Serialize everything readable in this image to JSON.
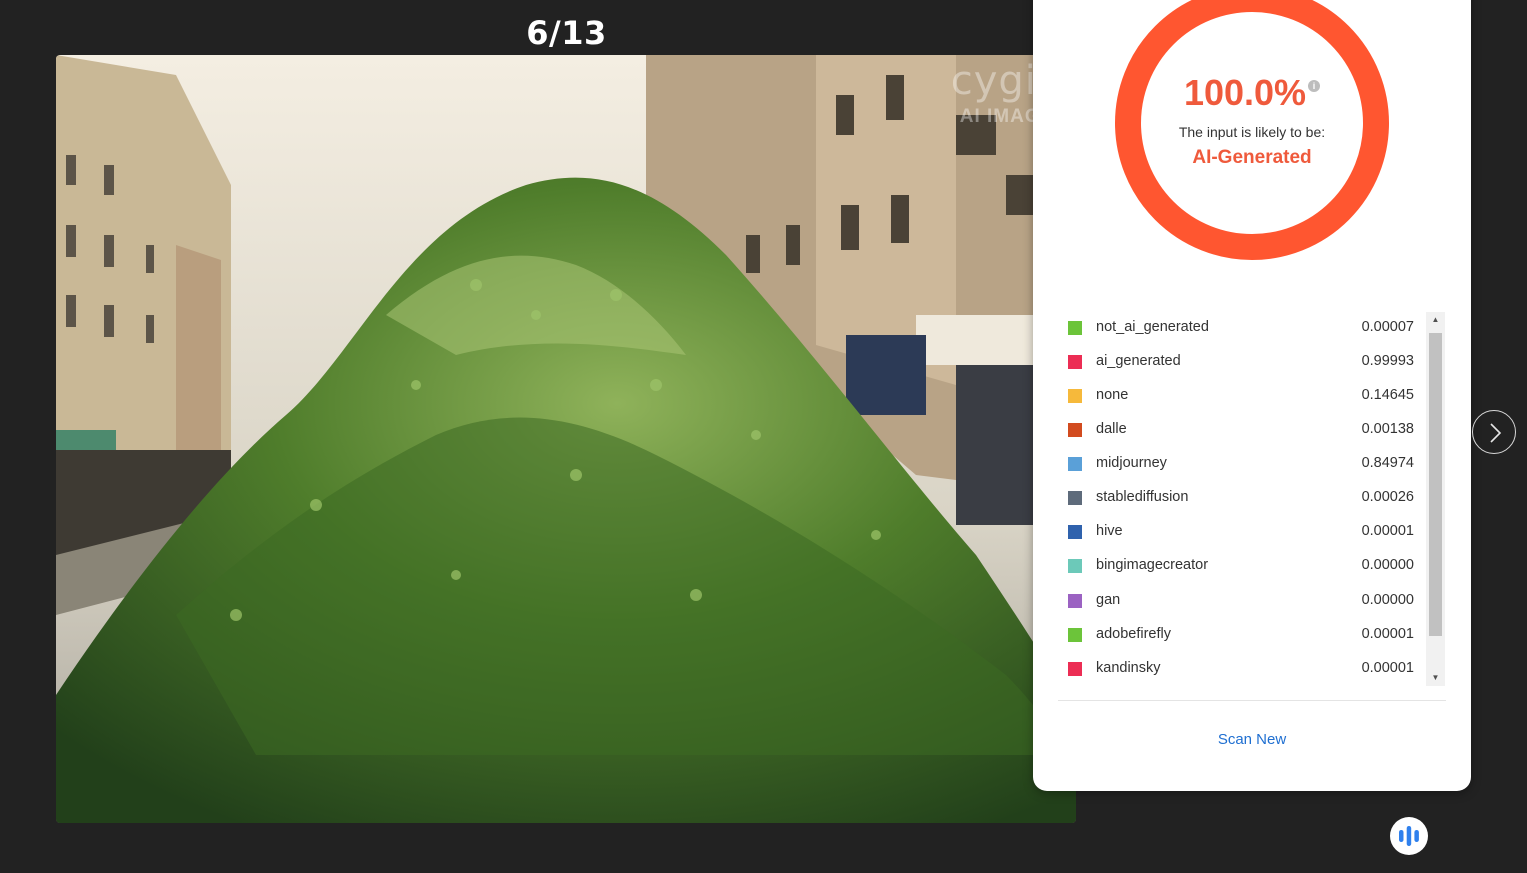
{
  "viewer": {
    "counter": "6/13",
    "watermark_line1": "cygig",
    "watermark_line2": "AI IMAGE"
  },
  "result": {
    "percent": "100.0%",
    "info_icon_glyph": "i",
    "likely_text": "The input is likely to be:",
    "verdict": "AI-Generated",
    "ring_color": "#ff5630",
    "accent_color": "#ef5a3c"
  },
  "classes": [
    {
      "name": "not_ai_generated",
      "value": "0.00007",
      "color": "#6cc43a"
    },
    {
      "name": "ai_generated",
      "value": "0.99993",
      "color": "#ec2d54"
    },
    {
      "name": "none",
      "value": "0.14645",
      "color": "#f6b93b"
    },
    {
      "name": "dalle",
      "value": "0.00138",
      "color": "#d24b1f"
    },
    {
      "name": "midjourney",
      "value": "0.84974",
      "color": "#5aa0d8"
    },
    {
      "name": "stablediffusion",
      "value": "0.00026",
      "color": "#5e6b7b"
    },
    {
      "name": "hive",
      "value": "0.00001",
      "color": "#2f62ad"
    },
    {
      "name": "bingimagecreator",
      "value": "0.00000",
      "color": "#6cc9b9"
    },
    {
      "name": "gan",
      "value": "0.00000",
      "color": "#9b62c2"
    },
    {
      "name": "adobefirefly",
      "value": "0.00001",
      "color": "#6cc43a"
    },
    {
      "name": "kandinsky",
      "value": "0.00001",
      "color": "#ec2d54"
    }
  ],
  "actions": {
    "scan_new": "Scan New",
    "next_icon": "chevron-right-icon",
    "fab_icon": "audio-bars-icon"
  }
}
